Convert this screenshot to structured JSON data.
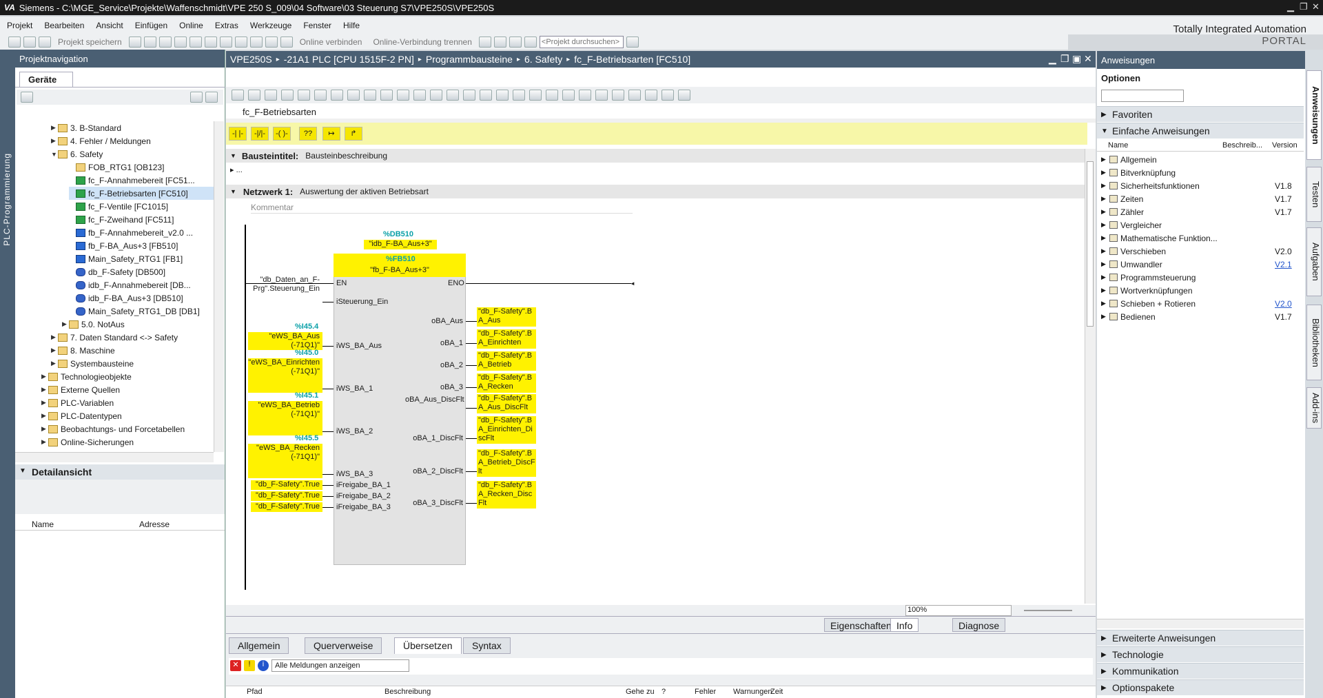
{
  "window": {
    "title": "Siemens  -  C:\\MGE_Service\\Projekte\\Waffenschmidt\\VPE 250 S_009\\04 Software\\03 Steuerung S7\\VPE250S\\VPE250S",
    "logo": "VA"
  },
  "menu": [
    "Projekt",
    "Bearbeiten",
    "Ansicht",
    "Einfügen",
    "Online",
    "Extras",
    "Werkzeuge",
    "Fenster",
    "Hilfe"
  ],
  "portal": {
    "line1": "Totally Integrated Automation",
    "line2": "PORTAL"
  },
  "toolbar": {
    "save": "Projekt speichern",
    "online_connect": "Online verbinden",
    "online_disconnect": "Online-Verbindung trennen",
    "search_placeholder": "<Projekt durchsuchen>"
  },
  "leftstrip": {
    "label": "PLC-Programmierung"
  },
  "projnav": {
    "title": "Projektnavigation",
    "tab": "Geräte",
    "items": [
      {
        "label": "3. B-Standard",
        "arrow": "▶",
        "icon": "f"
      },
      {
        "label": "4. Fehler / Meldungen",
        "arrow": "▶",
        "icon": "f"
      },
      {
        "label": "6. Safety",
        "arrow": "▼",
        "icon": "f"
      },
      {
        "label": "FOB_RTG1 [OB123]",
        "arrow": "",
        "icon": "f"
      },
      {
        "label": "fc_F-Annahmebereit [FC51...",
        "arrow": "",
        "icon": "g"
      },
      {
        "label": "fc_F-Betriebsarten [FC510]",
        "arrow": "",
        "icon": "g"
      },
      {
        "label": "fc_F-Ventile [FC1015]",
        "arrow": "",
        "icon": "g"
      },
      {
        "label": "fc_F-Zweihand [FC511]",
        "arrow": "",
        "icon": "g"
      },
      {
        "label": "fb_F-Annahmebereit_v2.0 ...",
        "arrow": "",
        "icon": "b"
      },
      {
        "label": "fb_F-BA_Aus+3 [FB510]",
        "arrow": "",
        "icon": "b"
      },
      {
        "label": "Main_Safety_RTG1 [FB1]",
        "arrow": "",
        "icon": "b"
      },
      {
        "label": "db_F-Safety [DB500]",
        "arrow": "",
        "icon": "db"
      },
      {
        "label": "idb_F-Annahmebereit [DB...",
        "arrow": "",
        "icon": "db"
      },
      {
        "label": "idb_F-BA_Aus+3 [DB510]",
        "arrow": "",
        "icon": "db"
      },
      {
        "label": "Main_Safety_RTG1_DB [DB1]",
        "arrow": "",
        "icon": "db"
      },
      {
        "label": "5.0. NotAus",
        "arrow": "▶",
        "icon": "f"
      },
      {
        "label": "7. Daten Standard <-> Safety",
        "arrow": "▶",
        "icon": "f"
      },
      {
        "label": "8. Maschine",
        "arrow": "▶",
        "icon": "f"
      },
      {
        "label": "Systembausteine",
        "arrow": "▶",
        "icon": "f"
      },
      {
        "label": "Technologieobjekte",
        "arrow": "▶",
        "icon": "f"
      },
      {
        "label": "Externe Quellen",
        "arrow": "▶",
        "icon": "f"
      },
      {
        "label": "PLC-Variablen",
        "arrow": "▶",
        "icon": "f"
      },
      {
        "label": "PLC-Datentypen",
        "arrow": "▶",
        "icon": "f"
      },
      {
        "label": "Beobachtungs- und Forcetabellen",
        "arrow": "▶",
        "icon": "f"
      },
      {
        "label": "Online-Sicherungen",
        "arrow": "▶",
        "icon": "f"
      }
    ]
  },
  "detail": {
    "title": "Detailansicht",
    "col_name": "Name",
    "col_addr": "Adresse"
  },
  "editor": {
    "breadcrumb": [
      "VPE250S",
      "-21A1 PLC [CPU 1515F-2 PN]",
      "Programmbausteine",
      "6. Safety",
      "fc_F-Betriebsarten [FC510]"
    ],
    "block_name": "fc_F-Betriebsarten",
    "block_title_label": "Bausteintitel:",
    "block_title_value": "Bausteinbeschreibung",
    "ellipsis": "...",
    "network_label": "Netzwerk 1:",
    "network_title": "Auswertung der aktiven Betriebsart",
    "comment": "Kommentar",
    "zoom": "100%",
    "db_addr": "%DB510",
    "db_name": "\"idb_F-BA_Aus+3\"",
    "fb_addr": "%FB510",
    "fb_name": "\"fb_F-BA_Aus+3\"",
    "en": "EN",
    "eno": "ENO",
    "inputs": [
      {
        "pin": "iSteuerung_Ein",
        "addr": "",
        "tag": "\"db_Daten_an_F-Prg\".Steuerung_Ein",
        "yellow": false
      },
      {
        "pin": "iWS_BA_Aus",
        "addr": "%I45.4",
        "tag": "\"eWS_BA_Aus (-71Q1)\"",
        "yellow": true
      },
      {
        "pin": "iWS_BA_1",
        "addr": "%I45.0",
        "tag": "\"eWS_BA_Einrichten (-71Q1)\"",
        "yellow": true
      },
      {
        "pin": "iWS_BA_2",
        "addr": "%I45.1",
        "tag": "\"eWS_BA_Betrieb (-71Q1)\"",
        "yellow": true
      },
      {
        "pin": "iWS_BA_3",
        "addr": "%I45.5",
        "tag": "\"eWS_BA_Recken (-71Q1)\"",
        "yellow": true
      },
      {
        "pin": "iFreigabe_BA_1",
        "addr": "",
        "tag": "\"db_F-Safety\".True",
        "yellow": true
      },
      {
        "pin": "iFreigabe_BA_2",
        "addr": "",
        "tag": "\"db_F-Safety\".True",
        "yellow": true
      },
      {
        "pin": "iFreigabe_BA_3",
        "addr": "",
        "tag": "\"db_F-Safety\".True",
        "yellow": true
      }
    ],
    "outputs": [
      {
        "pin": "oBA_Aus",
        "tag": "\"db_F-Safety\".BA_Aus"
      },
      {
        "pin": "oBA_1",
        "tag": "\"db_F-Safety\".BA_Einrichten"
      },
      {
        "pin": "oBA_2",
        "tag": "\"db_F-Safety\".BA_Betrieb"
      },
      {
        "pin": "oBA_3",
        "tag": "\"db_F-Safety\".BA_Recken"
      },
      {
        "pin": "oBA_Aus_DiscFlt",
        "tag": "\"db_F-Safety\".BA_Aus_DiscFlt"
      },
      {
        "pin": "oBA_1_DiscFlt",
        "tag": "\"db_F-Safety\".BA_Einrichten_DiscFlt"
      },
      {
        "pin": "oBA_2_DiscFlt",
        "tag": "\"db_F-Safety\".BA_Betrieb_DiscFlt"
      },
      {
        "pin": "oBA_3_DiscFlt",
        "tag": "\"db_F-Safety\".BA_Recken_DiscFlt"
      }
    ]
  },
  "inspector": {
    "right_tabs": [
      "Eigenschaften",
      "Info",
      "Diagnose"
    ],
    "tabs": [
      "Allgemein",
      "Querverweise",
      "Übersetzen",
      "Syntax"
    ],
    "filter": "Alle Meldungen anzeigen",
    "cols": [
      "Pfad",
      "Beschreibung",
      "Gehe zu",
      "?",
      "Fehler",
      "Warnungen",
      "Zeit"
    ]
  },
  "instructions": {
    "title": "Anweisungen",
    "options": "Optionen",
    "favorites": "Favoriten",
    "simple": "Einfache Anweisungen",
    "cols": [
      "Name",
      "Beschreib...",
      "Version"
    ],
    "rows": [
      {
        "name": "Allgemein",
        "ver": "",
        "link": false
      },
      {
        "name": "Bitverknüpfung",
        "ver": "",
        "link": false
      },
      {
        "name": "Sicherheitsfunktionen",
        "ver": "V1.8",
        "link": false
      },
      {
        "name": "Zeiten",
        "ver": "V1.7",
        "link": false
      },
      {
        "name": "Zähler",
        "ver": "V1.7",
        "link": false
      },
      {
        "name": "Vergleicher",
        "ver": "",
        "link": false
      },
      {
        "name": "Mathematische Funktion...",
        "ver": "",
        "link": false
      },
      {
        "name": "Verschieben",
        "ver": "V2.0",
        "link": false
      },
      {
        "name": "Umwandler",
        "ver": "V2.1",
        "link": true
      },
      {
        "name": "Programmsteuerung",
        "ver": "",
        "link": false
      },
      {
        "name": "Wortverknüpfungen",
        "ver": "",
        "link": false
      },
      {
        "name": "Schieben + Rotieren",
        "ver": "V2.0",
        "link": true
      },
      {
        "name": "Bedienen",
        "ver": "V1.7",
        "link": false
      }
    ],
    "bottom_sections": [
      "Erweiterte Anweisungen",
      "Technologie",
      "Kommunikation",
      "Optionspakete"
    ],
    "side_tabs": [
      "Anweisungen",
      "Testen",
      "Aufgaben",
      "Bibliotheken",
      "Add-ins"
    ]
  }
}
